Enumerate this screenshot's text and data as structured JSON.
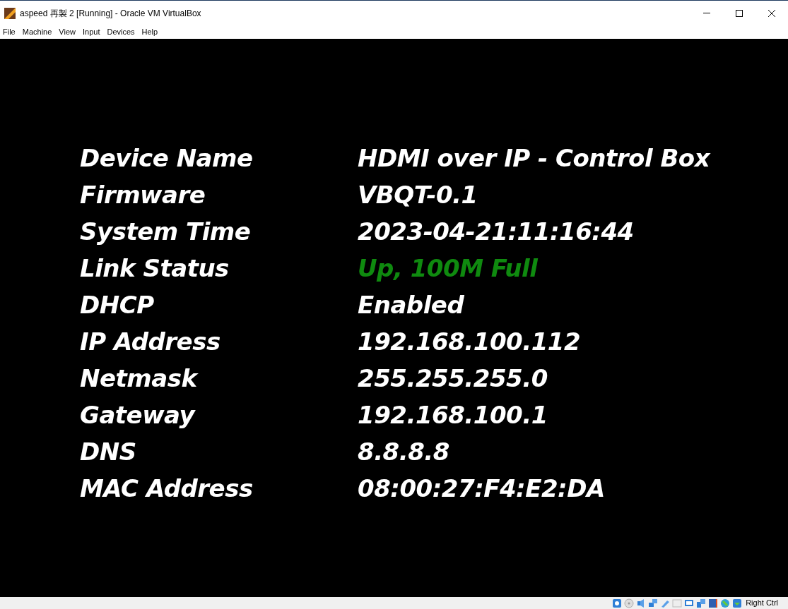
{
  "window": {
    "title": "aspeed 再製 2 [Running] - Oracle VM VirtualBox"
  },
  "menu": [
    "File",
    "Machine",
    "View",
    "Input",
    "Devices",
    "Help"
  ],
  "rows": [
    {
      "label": "Device Name",
      "value": "HDMI over IP - Control Box",
      "color": "#ffffff"
    },
    {
      "label": "Firmware",
      "value": "VBQT-0.1",
      "color": "#ffffff"
    },
    {
      "label": "System Time",
      "value": "2023-04-21:11:16:44",
      "color": "#ffffff"
    },
    {
      "label": "Link Status",
      "value": "Up, 100M Full",
      "color": "#0f8a0f"
    },
    {
      "label": "DHCP",
      "value": "Enabled",
      "color": "#ffffff"
    },
    {
      "label": "IP Address",
      "value": "192.168.100.112",
      "color": "#ffffff"
    },
    {
      "label": "Netmask",
      "value": "255.255.255.0",
      "color": "#ffffff"
    },
    {
      "label": "Gateway",
      "value": "192.168.100.1",
      "color": "#ffffff"
    },
    {
      "label": "DNS",
      "value": "8.8.8.8",
      "color": "#ffffff"
    },
    {
      "label": "MAC Address",
      "value": "08:00:27:F4:E2:DA",
      "color": "#ffffff"
    }
  ],
  "status_bar": {
    "host_key": "Right Ctrl"
  }
}
